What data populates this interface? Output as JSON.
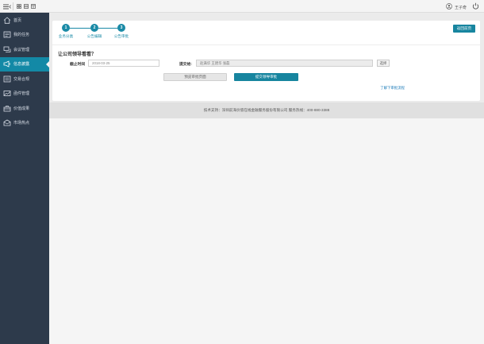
{
  "topbar": {
    "menu_icon": "menu-toggle-icon",
    "tools": [
      "grid-icon",
      "list-icon",
      "window-icon"
    ],
    "user_name": "王子奇",
    "power_icon": "power-icon"
  },
  "sidebar": {
    "items": [
      {
        "label": "首页",
        "icon": "home-icon"
      },
      {
        "label": "我的任务",
        "icon": "task-icon"
      },
      {
        "label": "会议管理",
        "icon": "meeting-icon"
      },
      {
        "label": "信息披露",
        "icon": "megaphone-icon",
        "active": true
      },
      {
        "label": "交易合规",
        "icon": "compliance-icon"
      },
      {
        "label": "函件管理",
        "icon": "mail-icon"
      },
      {
        "label": "价值成果",
        "icon": "value-icon"
      },
      {
        "label": "市场热点",
        "icon": "hotspot-icon"
      }
    ]
  },
  "steps": [
    {
      "num": "1",
      "label": "业务分类"
    },
    {
      "num": "2",
      "label": "公告编辑"
    },
    {
      "num": "3",
      "label": "公告审批"
    }
  ],
  "buttons": {
    "back": "返回前页",
    "select": "选择",
    "preview": "预览审批页面",
    "submit": "提交领导审批"
  },
  "form": {
    "question": "让公司领导看看？",
    "deadline_label": "截止时间",
    "deadline_value": "2018-03-25",
    "submit_to_label": "提交给:",
    "submit_to_value": "赵满华  王建华  张磊"
  },
  "links": {
    "flow": "了解下审批流程"
  },
  "footer": {
    "text": "技术支持：深圳前海价值在线金融服务股份有限公司  服务热线：400-880-3388"
  }
}
